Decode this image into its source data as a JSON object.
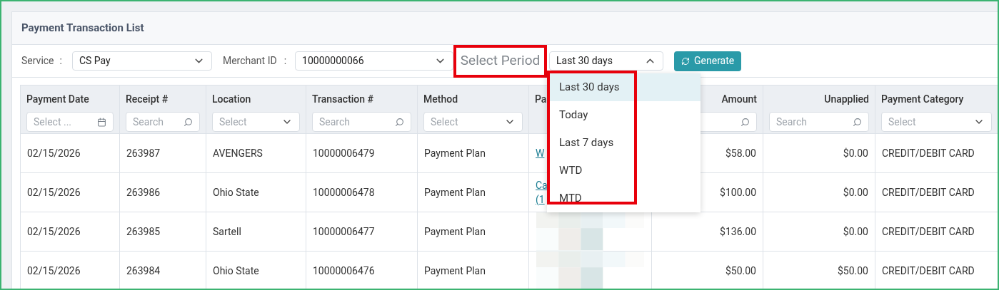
{
  "title": "Payment Transaction List",
  "filters": {
    "service": {
      "label": "Service",
      "separator": ":",
      "value": "CS Pay"
    },
    "merchant": {
      "label": "Merchant ID",
      "separator": ":",
      "value": "10000000066"
    },
    "period": {
      "label": "Select Period",
      "highlighted": true,
      "value": "Last 30 days",
      "expanded": true,
      "menu_highlighted": true,
      "options": [
        {
          "label": "Last 30 days",
          "selected": true
        },
        {
          "label": "Today",
          "selected": false
        },
        {
          "label": "Last 7 days",
          "selected": false
        },
        {
          "label": "WTD",
          "selected": false
        },
        {
          "label": "MTD",
          "selected": false
        }
      ]
    },
    "generate": {
      "label": "Generate"
    }
  },
  "columns": [
    {
      "label": "Payment Date",
      "filter": {
        "kind": "date",
        "placeholder": "Select ..."
      }
    },
    {
      "label": "Receipt #",
      "filter": {
        "kind": "search",
        "placeholder": "Search"
      }
    },
    {
      "label": "Location",
      "filter": {
        "kind": "select",
        "placeholder": "Select"
      }
    },
    {
      "label": "Transaction #",
      "filter": {
        "kind": "search",
        "placeholder": "Search"
      }
    },
    {
      "label": "Method",
      "filter": {
        "kind": "select",
        "placeholder": "Select"
      }
    },
    {
      "label": "Pa",
      "filter": {
        "kind": "none"
      }
    },
    {
      "label": "Amount",
      "filter": {
        "kind": "search"
      }
    },
    {
      "label": "Unapplied",
      "filter": {
        "kind": "search",
        "placeholder": "Search"
      }
    },
    {
      "label": "Payment Category",
      "filter": {
        "kind": "select",
        "placeholder": "Select"
      }
    }
  ],
  "rows": [
    {
      "cells": [
        {
          "kind": "text",
          "text": "02/15/2026"
        },
        {
          "kind": "text",
          "text": "263987"
        },
        {
          "kind": "text",
          "text": "AVENGERS"
        },
        {
          "kind": "text",
          "text": "10000006479"
        },
        {
          "kind": "text",
          "text": "Payment Plan"
        },
        {
          "kind": "link",
          "lines": [
            "W"
          ]
        },
        {
          "kind": "text",
          "text": "$58.00"
        },
        {
          "kind": "text",
          "text": "$0.00"
        },
        {
          "kind": "text",
          "text": "CREDIT/DEBIT CARD"
        }
      ]
    },
    {
      "cells": [
        {
          "kind": "text",
          "text": "02/15/2026"
        },
        {
          "kind": "text",
          "text": "263986"
        },
        {
          "kind": "text",
          "text": "Ohio State"
        },
        {
          "kind": "text",
          "text": "10000006478"
        },
        {
          "kind": "text",
          "text": "Payment Plan"
        },
        {
          "kind": "link",
          "lines": [
            "Ca",
            "(1"
          ]
        },
        {
          "kind": "text",
          "text": "$100.00"
        },
        {
          "kind": "text",
          "text": "$0.00"
        },
        {
          "kind": "text",
          "text": "CREDIT/DEBIT CARD"
        }
      ]
    },
    {
      "cells": [
        {
          "kind": "text",
          "text": "02/15/2026"
        },
        {
          "kind": "text",
          "text": "263985"
        },
        {
          "kind": "text",
          "text": "Sartell"
        },
        {
          "kind": "text",
          "text": "10000006477"
        },
        {
          "kind": "text",
          "text": "Payment Plan"
        },
        {
          "kind": "picture"
        },
        {
          "kind": "text",
          "text": "$136.00"
        },
        {
          "kind": "text",
          "text": "$0.00"
        },
        {
          "kind": "text",
          "text": "CREDIT/DEBIT CARD"
        }
      ]
    },
    {
      "cells": [
        {
          "kind": "text",
          "text": "02/15/2026"
        },
        {
          "kind": "text",
          "text": "263984"
        },
        {
          "kind": "text",
          "text": "Ohio State"
        },
        {
          "kind": "text",
          "text": "10000006476"
        },
        {
          "kind": "text",
          "text": "Payment Plan"
        },
        {
          "kind": "picture"
        },
        {
          "kind": "text",
          "text": "$50.00"
        },
        {
          "kind": "text",
          "text": "$50.00"
        },
        {
          "kind": "text",
          "text": "CREDIT/DEBIT CARD"
        }
      ]
    }
  ]
}
